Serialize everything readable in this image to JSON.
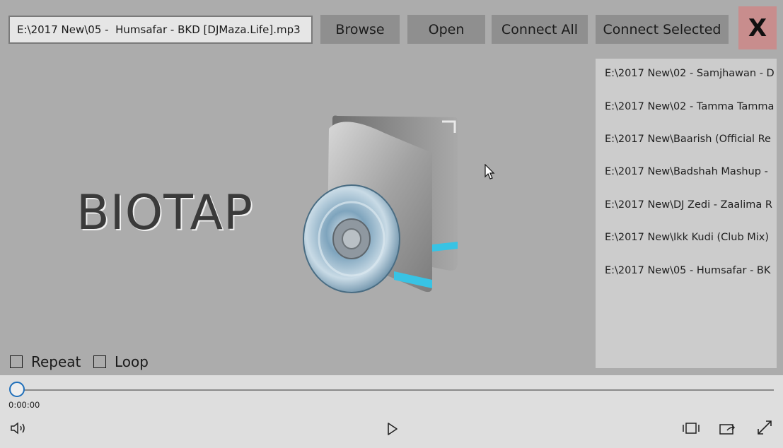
{
  "toolbar": {
    "path_value": "E:\\2017 New\\05 -  Humsafar - BKD [DJMaza.Life].mp3",
    "browse_label": "Browse",
    "open_label": "Open",
    "connect_all_label": "Connect All",
    "connect_selected_label": "Connect Selected",
    "close_label": "X"
  },
  "brand": {
    "title": "BIOTAP"
  },
  "playlist": {
    "items": [
      "E:\\2017 New\\02 - Samjhawan - D",
      "E:\\2017 New\\02 - Tamma Tamma",
      "E:\\2017 New\\Baarish (Official Re",
      "E:\\2017 New\\Badshah Mashup - ",
      "E:\\2017 New\\DJ Zedi - Zaalima R",
      "E:\\2017 New\\Ikk Kudi (Club Mix)",
      "E:\\2017 New\\05 -  Humsafar - BK"
    ]
  },
  "options": {
    "repeat_label": "Repeat",
    "loop_label": "Loop",
    "repeat_checked": false,
    "loop_checked": false
  },
  "player": {
    "time": "0:00:00",
    "progress": 0,
    "icons": [
      "volume-icon",
      "play-icon",
      "aspect-ratio-icon",
      "cast-icon",
      "fullscreen-icon"
    ]
  }
}
